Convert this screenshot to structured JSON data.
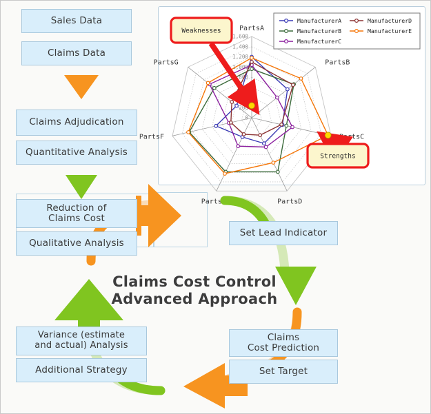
{
  "diagram": {
    "center_title": "Claims Cost Control\nAdvanced Approach"
  },
  "left_flow": {
    "boxes": [
      {
        "label": "Sales Data"
      },
      {
        "label": "Claims Data"
      },
      {
        "label": "Claims Adjudication"
      },
      {
        "label": "Quantitative Analysis"
      },
      {
        "label": "Reduction of\nClaims Cost"
      },
      {
        "label": "Qualitative Analysis"
      }
    ]
  },
  "bottom_left_flow": {
    "boxes": [
      {
        "label": "Variance (estimate\nand actual) Analysis"
      },
      {
        "label": "Additional Strategy"
      }
    ]
  },
  "right_flow": {
    "boxes": [
      {
        "label": "Set Lead Indicator"
      },
      {
        "label": "Claims\nCost Prediction"
      },
      {
        "label": "Set Target"
      }
    ]
  },
  "callouts": [
    {
      "id": "weaknesses",
      "label": "Weaknesses"
    },
    {
      "id": "strengths",
      "label": "Strengths"
    }
  ],
  "colors": {
    "box_fill": "#d9eefb",
    "box_border": "#a8c8dd",
    "orange": "#f79420",
    "green": "#80c520",
    "callout_border": "#ee1c1c",
    "callout_fill": "#fcf6cd",
    "marker_highlight": "#ffd700"
  },
  "chart_data": {
    "type": "radar",
    "title": "",
    "categories": [
      "PartsA",
      "PartsB",
      "PartsC",
      "PartsD",
      "PartsE",
      "PartsF",
      "PartsG"
    ],
    "tick_labels": [
      "0",
      "200",
      "400",
      "600",
      "800",
      "1,000",
      "1,200",
      "1,400",
      "1,600"
    ],
    "rlim": [
      0,
      1600
    ],
    "grid": true,
    "legend_position": "top-right",
    "legend_entries": [
      {
        "name": "ManufacturerA",
        "color": "#3a3ab5"
      },
      {
        "name": "ManufacturerB",
        "color": "#3c6b3c"
      },
      {
        "name": "ManufacturerC",
        "color": "#8b1f9e"
      },
      {
        "name": "ManufacturerD",
        "color": "#8c3434"
      },
      {
        "name": "ManufacturerE",
        "color": "#f5770a"
      }
    ],
    "series": [
      {
        "name": "ManufacturerA",
        "color": "#3a3ab5",
        "values": [
          1200,
          900,
          620,
          560,
          420,
          720,
          380
        ]
      },
      {
        "name": "ManufacturerB",
        "color": "#3c6b3c",
        "values": [
          960,
          1060,
          700,
          1180,
          1180,
          1260,
          940
        ]
      },
      {
        "name": "ManufacturerC",
        "color": "#8b1f9e",
        "values": [
          1040,
          640,
          820,
          640,
          620,
          460,
          1060
        ]
      },
      {
        "name": "ManufacturerD",
        "color": "#8c3434",
        "values": [
          1100,
          1040,
          600,
          380,
          360,
          420,
          500
        ]
      },
      {
        "name": "ManufacturerE",
        "color": "#f5770a",
        "values": [
          1180,
          1240,
          1540,
          980,
          1220,
          1280,
          1100
        ]
      }
    ],
    "annotations": [
      {
        "label": "Weaknesses",
        "target_category": "PartsA",
        "target_value": 240
      },
      {
        "label": "Strengths",
        "target_category": "PartsC",
        "target_value": 1540
      }
    ]
  }
}
